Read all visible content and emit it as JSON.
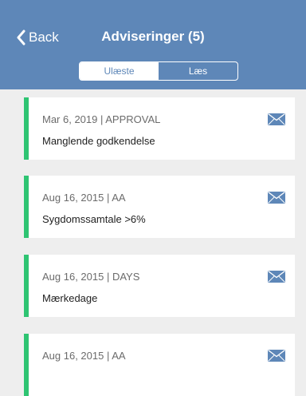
{
  "header": {
    "back_label": "Back",
    "title": "Adviseringer (5)",
    "tabs": [
      {
        "label": "Ulæste",
        "active": true
      },
      {
        "label": "Læs",
        "active": false
      }
    ]
  },
  "notifications": [
    {
      "meta": "Mar 6, 2019 | APPROVAL",
      "subject": "Manglende godkendelse",
      "icon": "envelope-icon"
    },
    {
      "meta": "Aug 16, 2015 | AA",
      "subject": "Sygdomssamtale >6%",
      "icon": "envelope-icon"
    },
    {
      "meta": "Aug 16, 2015 | DAYS",
      "subject": "Mærkedage",
      "icon": "envelope-icon"
    },
    {
      "meta": "Aug 16, 2015 | AA",
      "subject": "",
      "icon": "envelope-icon"
    }
  ],
  "colors": {
    "header_bg": "#5e87b8",
    "accent_bar": "#2ec472",
    "envelope": "#5e87b8",
    "page_bg": "#eeeeee"
  }
}
